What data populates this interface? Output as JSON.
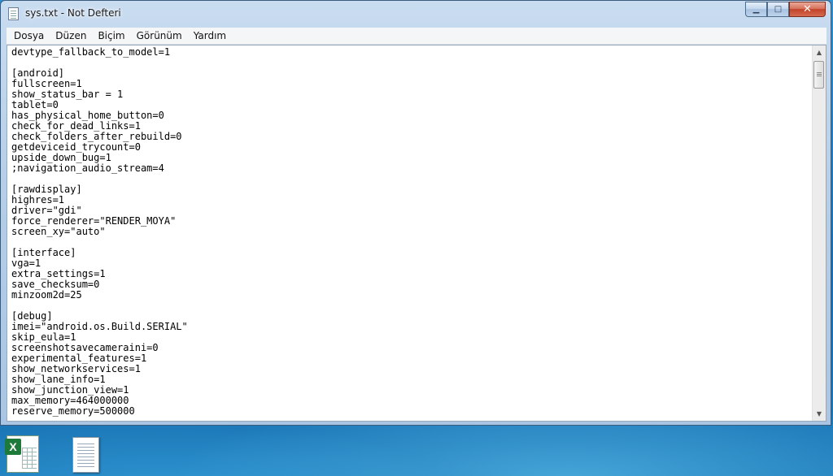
{
  "window": {
    "title": "sys.txt - Not Defteri",
    "minimize_glyph": "▁",
    "maximize_glyph": "□",
    "close_glyph": "✕"
  },
  "menu": [
    "Dosya",
    "Düzen",
    "Biçim",
    "Görünüm",
    "Yardım"
  ],
  "editor": {
    "lines": [
      "devtype_fallback_to_model=1",
      "",
      "[android]",
      "fullscreen=1",
      "show_status_bar = 1",
      "tablet=0",
      "has_physical_home_button=0",
      "check_for_dead_links=1",
      "check_folders_after_rebuild=0",
      "getdeviceid_trycount=0",
      "upside_down_bug=1",
      ";navigation_audio_stream=4",
      "",
      "[rawdisplay]",
      "highres=1",
      "driver=\"gdi\"",
      "force_renderer=\"RENDER_MOYA\"",
      "screen_xy=\"auto\"",
      "",
      "[interface]",
      "vga=1",
      "extra_settings=1",
      "save_checksum=0",
      "minzoom2d=25",
      "",
      "[debug]",
      "imei=\"android.os.Build.SERIAL\"",
      "skip_eula=1",
      "screenshotsavecameraini=0",
      "experimental_features=1",
      "show_networkservices=1",
      "show_lane_info=1",
      "show_junction_view=1",
      "max_memory=464000000",
      "reserve_memory=500000"
    ]
  },
  "scrollbar": {
    "up_glyph": "▲",
    "down_glyph": "▼"
  },
  "desktop": {
    "icons": [
      {
        "name": "excel-file",
        "badge": "X"
      },
      {
        "name": "text-file"
      }
    ]
  }
}
